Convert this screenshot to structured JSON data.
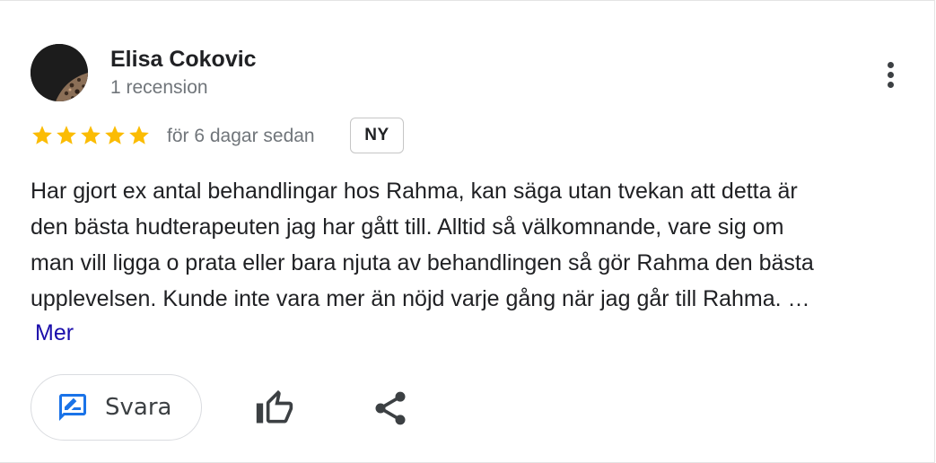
{
  "reviewer": {
    "name": "Elisa Cokovic",
    "review_count": "1 recension",
    "avatar_icon": "avatar-photo"
  },
  "rating": {
    "stars": 5,
    "max_stars": 5,
    "star_color": "#fbbc04",
    "date": "för 6 dagar sedan",
    "badge": "NY"
  },
  "review": {
    "lines": [
      "Har gjort ex antal behandlingar hos Rahma, kan säga utan tvekan att detta är",
      "den bästa hudterapeuten jag har gått till. Alltid så välkomnande, vare sig om",
      "man vill ligga o prata eller bara njuta av behandlingen så gör Rahma den bästa",
      "upplevelsen. Kunde inte vara mer än nöjd varje gång när jag går till Rahma. …"
    ],
    "more_label": "Mer",
    "link_color": "#1a0dab"
  },
  "actions": {
    "reply_label": "Svara",
    "reply_icon": "rate-review-icon",
    "like_icon": "thumb-up-icon",
    "share_icon": "share-icon",
    "menu_icon": "more-vert-icon",
    "accent_color": "#1a73e8"
  }
}
